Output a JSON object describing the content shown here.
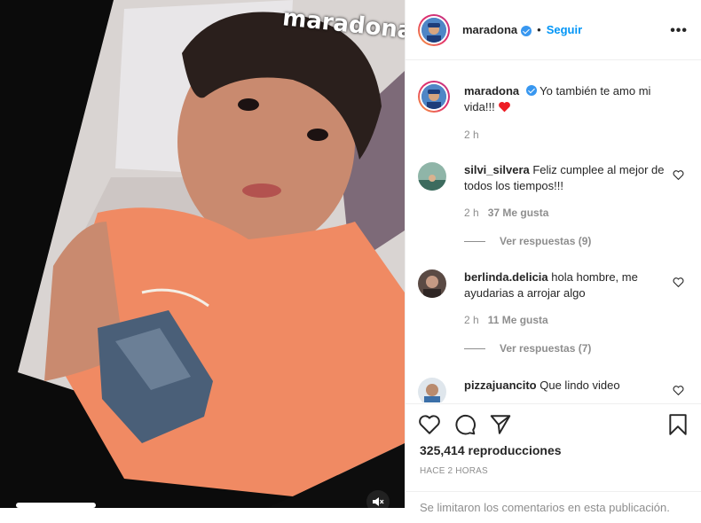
{
  "header": {
    "username": "maradona",
    "separator": "•",
    "follow_label": "Seguir",
    "more_label": "•••"
  },
  "video": {
    "overlay_text": "maradona"
  },
  "caption": {
    "username": "maradona",
    "text": "Yo también te amo mi vida!!!",
    "time": "2 h"
  },
  "comments": [
    {
      "username": "silvi_silvera",
      "text": "Feliz cumplee al mejor de todos los tiempos!!!",
      "time": "2 h",
      "likes": "37 Me gusta",
      "replies": "Ver respuestas (9)"
    },
    {
      "username": "berlinda.delicia",
      "text": "hola hombre, me ayudarias a arrojar algo",
      "time": "2 h",
      "likes": "11 Me gusta",
      "replies": "Ver respuestas (7)"
    },
    {
      "username": "pizzajuancito",
      "text": "Que lindo video"
    }
  ],
  "stats": {
    "views": "325,414 reproducciones",
    "time_ago": "HACE 2 HORAS"
  },
  "footer": {
    "limited_comments": "Se limitaron los comentarios en esta publicación."
  },
  "colors": {
    "accent": "#0095f6",
    "verified": "#3897f0",
    "heart": "#ed1c24",
    "muted_text": "#8e8e8e"
  }
}
